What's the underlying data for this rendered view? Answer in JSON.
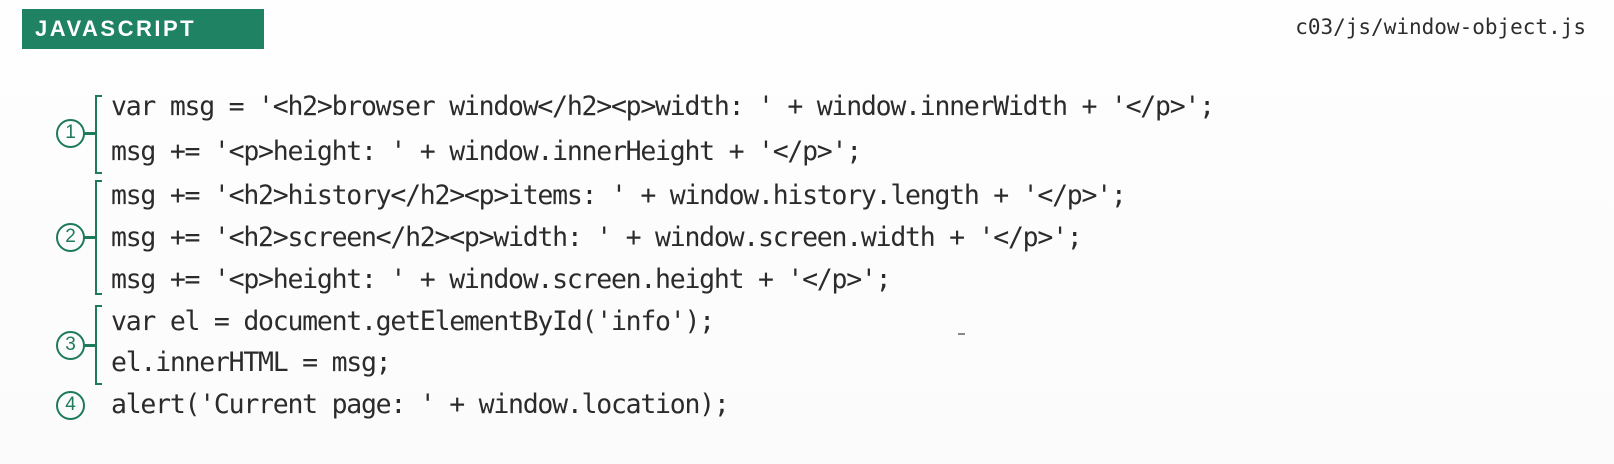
{
  "header": {
    "language_label": "JAVASCRIPT",
    "file_path": "c03/js/window-object.js"
  },
  "colors": {
    "accent": "#1e8263",
    "code_text": "#2b2b2b"
  },
  "annotations": [
    "1",
    "2",
    "3",
    "4"
  ],
  "code": {
    "lines": [
      "var msg = '<h2>browser window</h2><p>width: ' + window.innerWidth + '</p>';",
      "msg += '<p>height: ' + window.innerHeight + '</p>';",
      "msg += '<h2>history</h2><p>items: ' + window.history.length + '</p>';",
      "msg += '<h2>screen</h2><p>width: ' + window.screen.width + '</p>';",
      "msg += '<p>height: ' + window.screen.height + '</p>';",
      "var el = document.getElementById('info');",
      "el.innerHTML = msg;",
      "alert('Current page: ' + window.location);"
    ]
  }
}
